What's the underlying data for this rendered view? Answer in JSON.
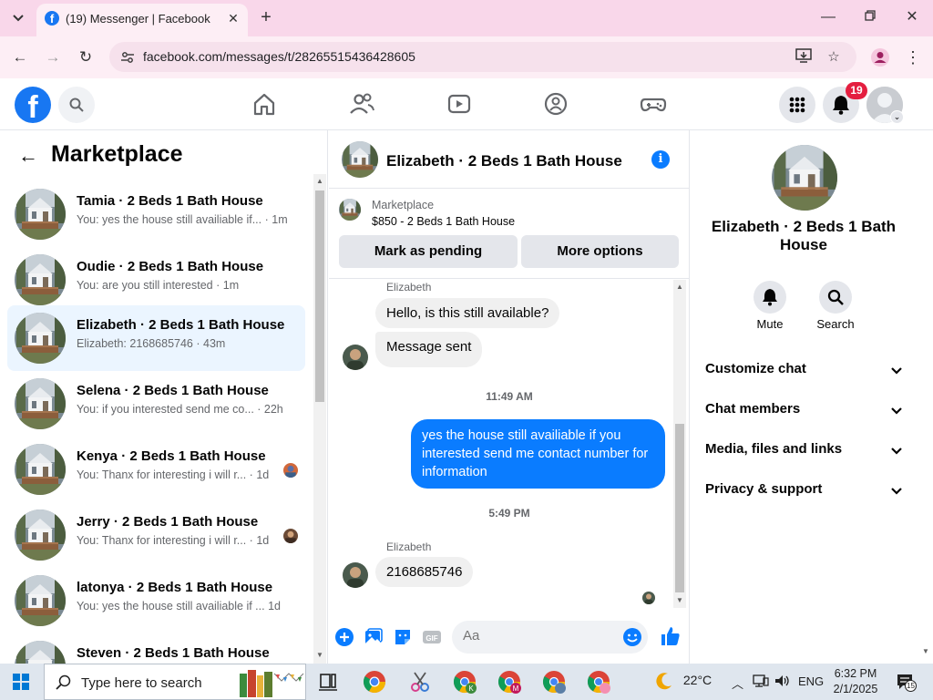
{
  "browser": {
    "tab_title": "(19) Messenger | Facebook",
    "tab_icon": "facebook-icon",
    "url": "facebook.com/messages/t/28265515436428605"
  },
  "fb_header": {
    "notification_count": "19",
    "nav_icons": [
      "home-icon",
      "friends-icon",
      "watch-icon",
      "groups-icon",
      "gaming-icon"
    ],
    "brand_color": "#1877f2"
  },
  "left_panel": {
    "title": "Marketplace",
    "conversations": [
      {
        "name": "Tamia · 2 Beds 1 Bath House",
        "preview": "You: yes the house still availiable if... · 1m",
        "active": false
      },
      {
        "name": "Oudie · 2 Beds 1 Bath House",
        "preview": "You: are you still interested · 1m",
        "active": false
      },
      {
        "name": "Elizabeth · 2 Beds 1 Bath House",
        "preview": "Elizabeth: 2168685746 · 43m",
        "active": true
      },
      {
        "name": "Selena · 2 Beds 1 Bath House",
        "preview": "You: if you interested send me co... · 22h",
        "active": false
      },
      {
        "name": "Kenya · 2 Beds 1 Bath House",
        "preview": "You: Thanx for interesting i will r... · 1d",
        "active": false
      },
      {
        "name": "Jerry · 2 Beds 1 Bath House",
        "preview": "You: Thanx for interesting i will r... · 1d",
        "active": false
      },
      {
        "name": "latonya · 2 Beds 1 Bath House",
        "preview": "You: yes the house still availiable if ... 1d",
        "active": false
      },
      {
        "name": "Steven · 2 Beds 1 Bath House",
        "preview": "",
        "active": false
      }
    ]
  },
  "chat": {
    "title": "Elizabeth · 2 Beds 1 Bath House",
    "listing_source": "Marketplace",
    "listing_price": "$850 - 2 Beds 1 Bath House",
    "mark_pending_label": "Mark as pending",
    "more_options_label": "More options",
    "sender1": "Elizabeth",
    "msg1": "Hello, is this still available?",
    "msg2": "Message sent",
    "time1": "11:49 AM",
    "out_msg": "yes the house still availiable if you interested send me contact number for information",
    "time2": "5:49 PM",
    "sender2": "Elizabeth",
    "msg3": "2168685746",
    "composer_placeholder": "Aa",
    "accent_color": "#0a7cff"
  },
  "right_panel": {
    "name": "Elizabeth · 2 Beds 1 Bath House",
    "mute_label": "Mute",
    "search_label": "Search",
    "sections": [
      "Customize chat",
      "Chat members",
      "Media, files and links",
      "Privacy & support"
    ]
  },
  "taskbar": {
    "search_placeholder": "Type here to search",
    "temperature": "22°C",
    "language": "ENG",
    "time": "6:32 PM",
    "date": "2/1/2025",
    "notif_count": "15"
  }
}
